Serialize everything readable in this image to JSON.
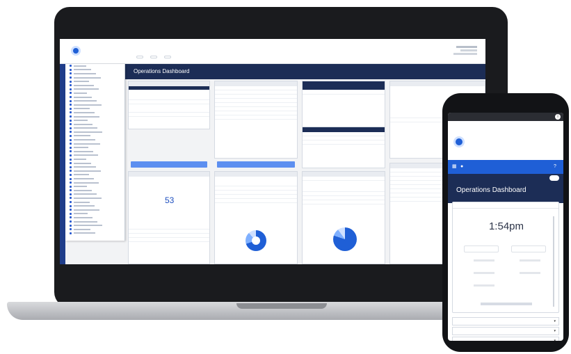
{
  "laptop": {
    "app": {
      "topnav": [
        "",
        "",
        ""
      ],
      "dashboard_title": "Operations Dashboard",
      "kpi_value": "53",
      "sidebar_items_count": 44
    }
  },
  "phone": {
    "dashboard_title": "Operations Dashboard",
    "clock": "1:54pm",
    "list_items": [
      "",
      "",
      ""
    ]
  },
  "colors": {
    "brand_navy": "#1c2d56",
    "accent_blue": "#1f5fd6",
    "button_blue": "#5d8ff0"
  }
}
